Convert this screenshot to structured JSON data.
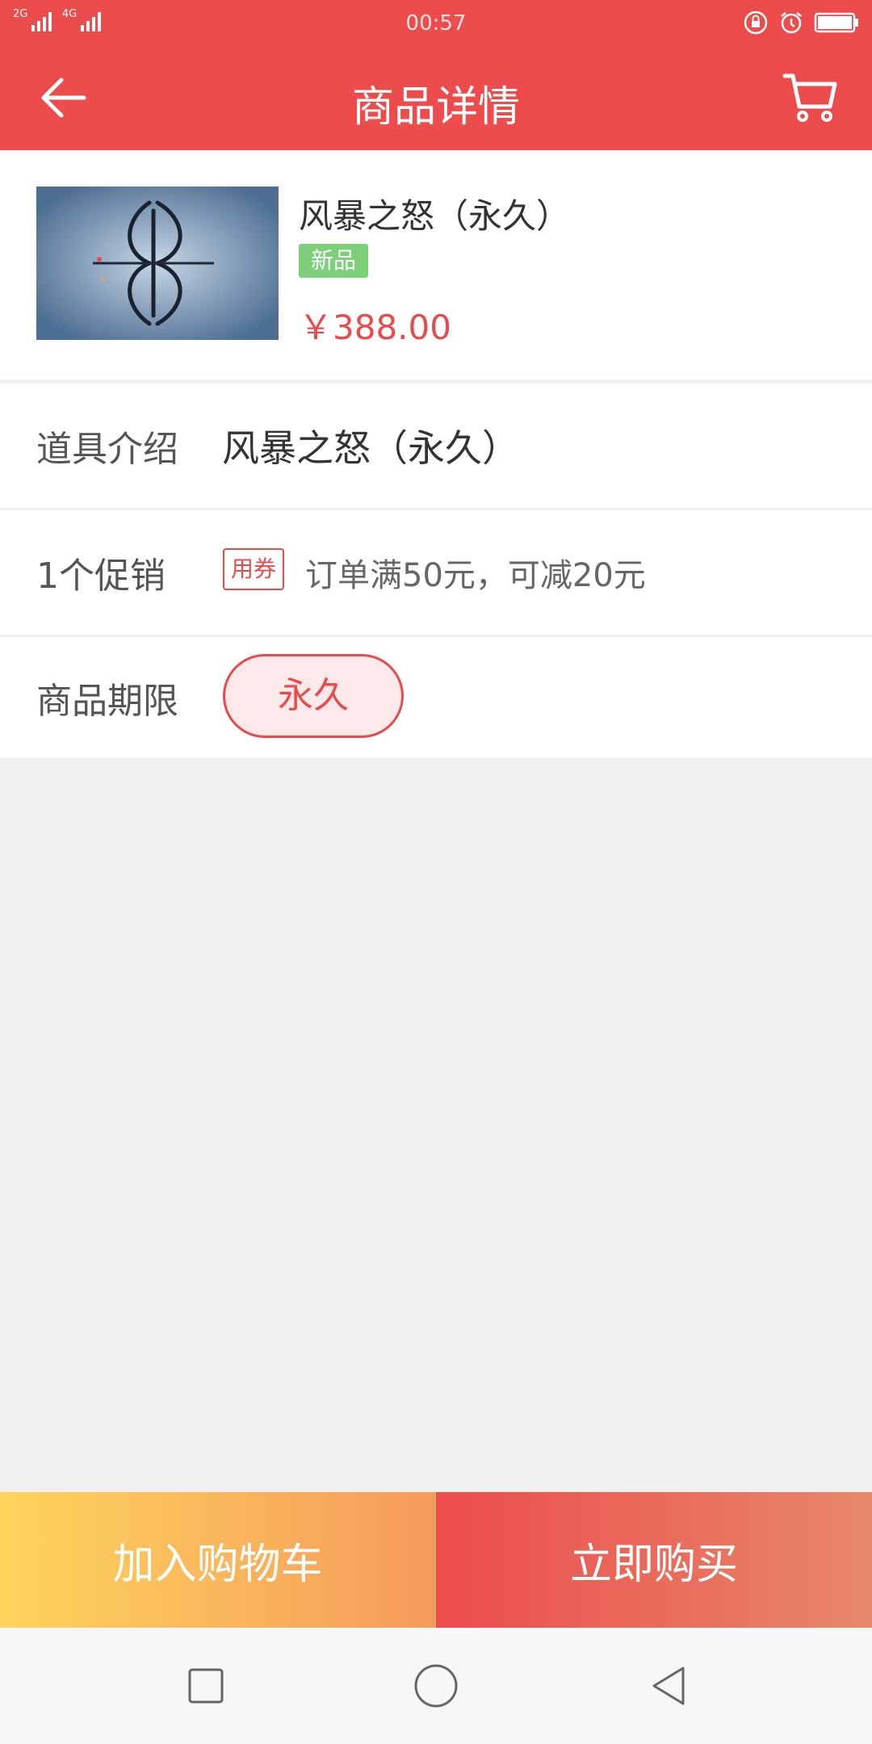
{
  "status_bar": {
    "time": "00:57",
    "net_2g": "2G",
    "net_4g": "4G",
    "icons": [
      "signal-icon",
      "lock-rotation-icon",
      "alarm-icon",
      "battery-icon"
    ]
  },
  "header": {
    "title": "商品详情",
    "back_icon": "back-arrow-icon",
    "cart_icon": "shopping-cart-icon"
  },
  "product": {
    "name": "风暴之怒（永久）",
    "badge": "新品",
    "price": "￥388.00"
  },
  "details": {
    "intro_label": "道具介绍",
    "intro_value": "风暴之怒（永久）",
    "promo_label": "1个促销",
    "coupon_tag": "用券",
    "promo_text": "订单满50元，可减20元",
    "term_label": "商品期限",
    "term_value": "永久"
  },
  "actions": {
    "add_to_cart": "加入购物车",
    "buy_now": "立即购买"
  },
  "colors": {
    "primary": "#ec4c4c",
    "badge_green": "#7dcf7a"
  }
}
